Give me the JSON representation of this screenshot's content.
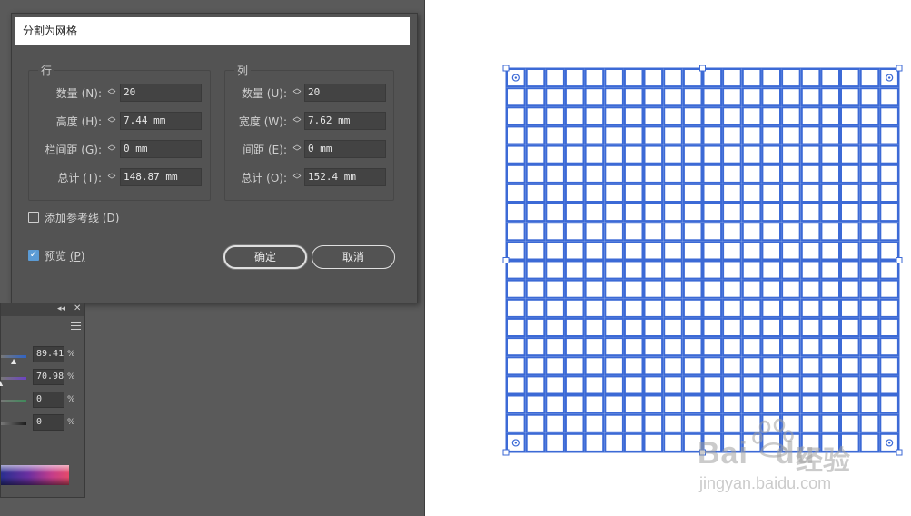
{
  "dialog": {
    "title": "分割为网格",
    "rows": {
      "group_title": "行",
      "fields": [
        {
          "label": "数量 (N):",
          "value": "20"
        },
        {
          "label": "高度 (H):",
          "value": "7.44 mm"
        },
        {
          "label": "栏间距 (G):",
          "value": "0 mm"
        },
        {
          "label": "总计 (T):",
          "value": "148.87 mm"
        }
      ]
    },
    "columns": {
      "group_title": "列",
      "fields": [
        {
          "label": "数量 (U):",
          "value": "20"
        },
        {
          "label": "宽度 (W):",
          "value": "7.62 mm"
        },
        {
          "label": "间距 (E):",
          "value": "0 mm"
        },
        {
          "label": "总计 (O):",
          "value": "152.4 mm"
        }
      ]
    },
    "add_guides": {
      "label": "添加参考线",
      "shortcut": "(D)",
      "checked": false
    },
    "preview": {
      "label": "预览",
      "shortcut": "(P)",
      "checked": true
    },
    "ok_label": "确定",
    "cancel_label": "取消"
  },
  "color_panel": {
    "values": [
      {
        "value": "89.41",
        "unit": "%",
        "color": "#2f63c6",
        "level": 0.894
      },
      {
        "value": "70.98",
        "unit": "%",
        "color": "#6c42c4",
        "level": 0.709
      },
      {
        "value": "0",
        "unit": "%",
        "color": "#3e8a5a",
        "level": 0
      },
      {
        "value": "0",
        "unit": "%",
        "color": "#1c1c1c",
        "level": 0
      }
    ]
  },
  "canvas": {
    "grid": {
      "rows": 20,
      "columns": 20,
      "stroke_color": "#3c6ad6"
    }
  },
  "watermark": {
    "logo_text": "Bai",
    "logo_text2": "du",
    "jingyan": "经验",
    "url": "jingyan.baidu.com"
  }
}
